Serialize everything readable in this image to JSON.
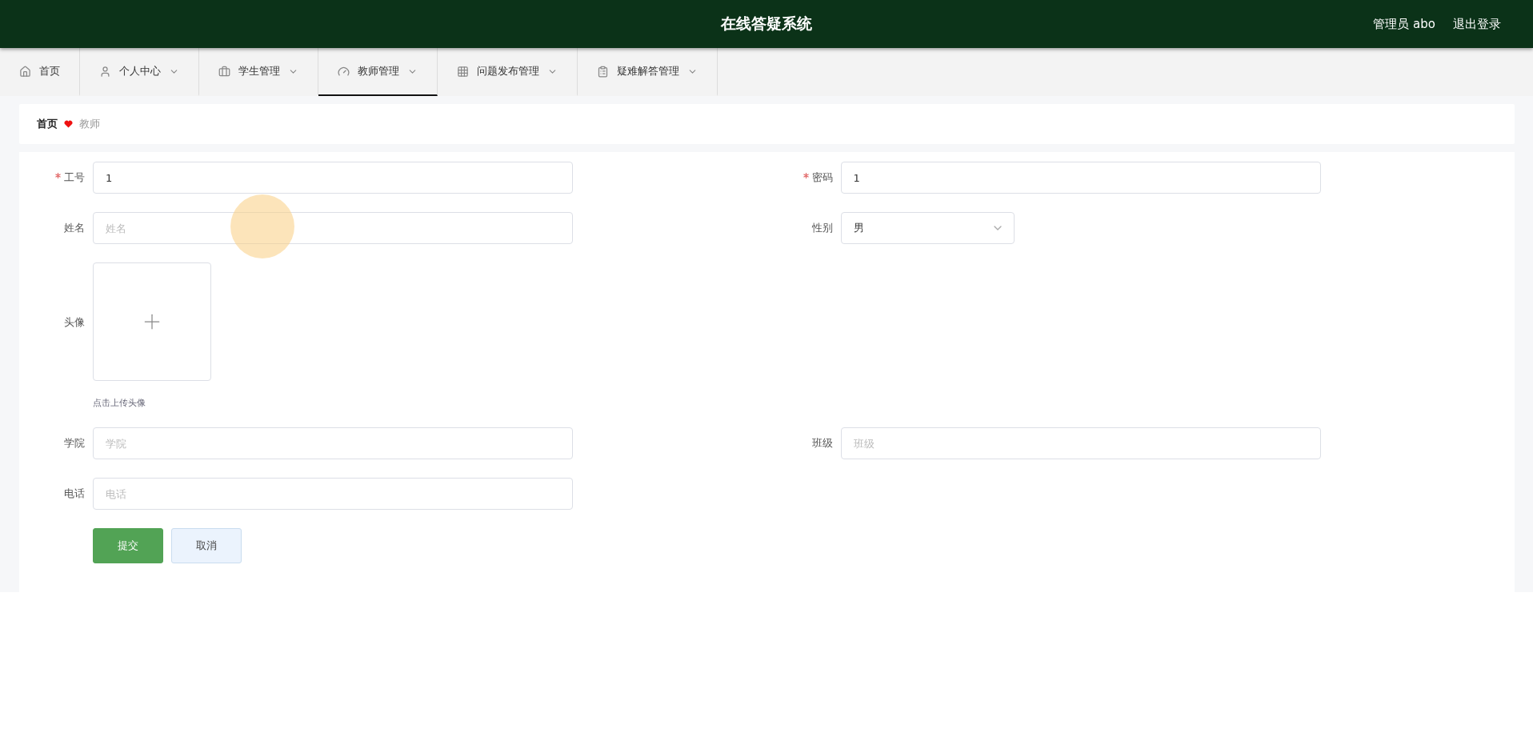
{
  "header": {
    "title": "在线答疑系统",
    "user": "管理员 abo",
    "logout": "退出登录"
  },
  "tabs": [
    {
      "label": "首页",
      "selected": false,
      "dropdown": false
    },
    {
      "label": "个人中心",
      "selected": false,
      "dropdown": true
    },
    {
      "label": "学生管理",
      "selected": false,
      "dropdown": true
    },
    {
      "label": "教师管理",
      "selected": true,
      "dropdown": true
    },
    {
      "label": "问题发布管理",
      "selected": false,
      "dropdown": true
    },
    {
      "label": "疑难解答管理",
      "selected": false,
      "dropdown": true
    }
  ],
  "breadcrumb": {
    "home": "首页",
    "current": "教师"
  },
  "form": {
    "rows": [
      [
        {
          "kind": "input",
          "label": "工号",
          "required": true,
          "value": "1"
        },
        {
          "kind": "input",
          "label": "密码",
          "required": true,
          "value": "1"
        }
      ],
      [
        {
          "kind": "input",
          "label": "姓名",
          "required": false,
          "placeholder": "姓名"
        },
        {
          "kind": "select",
          "label": "性别",
          "required": false,
          "value": "男"
        }
      ],
      [
        {
          "kind": "upload",
          "label": "头像",
          "required": false,
          "hint": "点击上传头像"
        }
      ],
      [
        {
          "kind": "input",
          "label": "学院",
          "required": false,
          "placeholder": "学院"
        },
        {
          "kind": "input",
          "label": "班级",
          "required": false,
          "placeholder": "班级"
        }
      ],
      [
        {
          "kind": "input",
          "label": "电话",
          "required": false,
          "placeholder": "电话"
        }
      ]
    ],
    "buttons": [
      {
        "kind": "primary",
        "label": "提交"
      },
      {
        "kind": "secondary",
        "label": "取消"
      }
    ]
  }
}
